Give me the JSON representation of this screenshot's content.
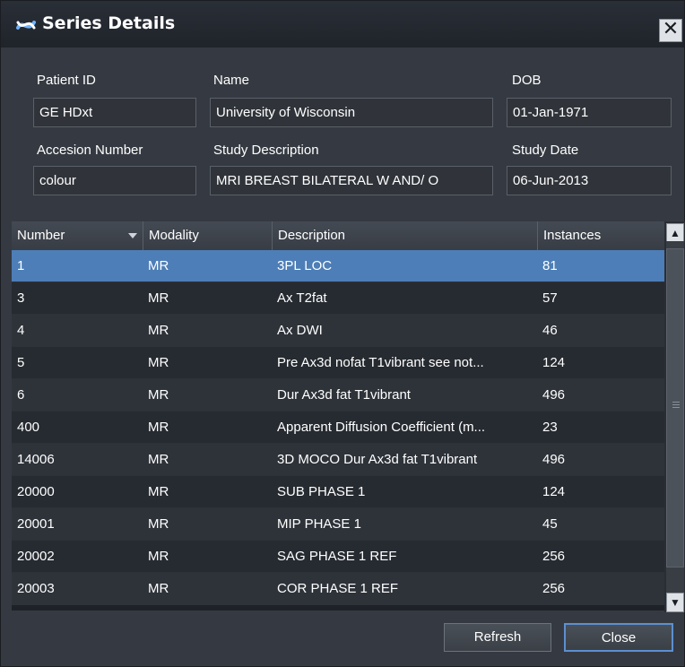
{
  "window": {
    "title": "Series Details",
    "close_glyph": "✕",
    "title_icon": "dna-helix-icon"
  },
  "patient": {
    "patient_id_label": "Patient ID",
    "patient_id_value": "GE HDxt",
    "name_label": "Name",
    "name_value": "University of Wisconsin",
    "dob_label": "DOB",
    "dob_value": "01-Jan-1971",
    "accession_label": "Accesion Number",
    "accession_value": "colour",
    "study_desc_label": "Study Description",
    "study_desc_value": "MRI BREAST BILATERAL W AND/ O",
    "study_date_label": "Study Date",
    "study_date_value": "06-Jun-2013"
  },
  "table": {
    "columns": [
      "Number",
      "Modality",
      "Description",
      "Instances"
    ],
    "sort_column": "Number",
    "selected_row": 0,
    "rows": [
      {
        "number": "1",
        "modality": "MR",
        "description": "3PL LOC",
        "instances": "81"
      },
      {
        "number": "3",
        "modality": "MR",
        "description": "Ax T2fat",
        "instances": "57"
      },
      {
        "number": "4",
        "modality": "MR",
        "description": "Ax DWI",
        "instances": "46"
      },
      {
        "number": "5",
        "modality": "MR",
        "description": "Pre Ax3d nofat T1vibrant  see not...",
        "instances": "124"
      },
      {
        "number": "6",
        "modality": "MR",
        "description": "Dur Ax3d fat T1vibrant",
        "instances": "496"
      },
      {
        "number": "400",
        "modality": "MR",
        "description": "Apparent Diffusion Coefficient (m...",
        "instances": "23"
      },
      {
        "number": "14006",
        "modality": "MR",
        "description": "3D MOCO Dur Ax3d fat T1vibrant",
        "instances": "496"
      },
      {
        "number": "20000",
        "modality": "MR",
        "description": "SUB PHASE 1",
        "instances": "124"
      },
      {
        "number": "20001",
        "modality": "MR",
        "description": "MIP PHASE 1",
        "instances": "45"
      },
      {
        "number": "20002",
        "modality": "MR",
        "description": "SAG PHASE 1 REF",
        "instances": "256"
      },
      {
        "number": "20003",
        "modality": "MR",
        "description": "COR PHASE 1 REF",
        "instances": "256"
      }
    ]
  },
  "buttons": {
    "refresh": "Refresh",
    "close": "Close"
  },
  "colors": {
    "selection": "#4d7eb7",
    "background": "#353a42",
    "accent_border": "#5d8fd0"
  }
}
